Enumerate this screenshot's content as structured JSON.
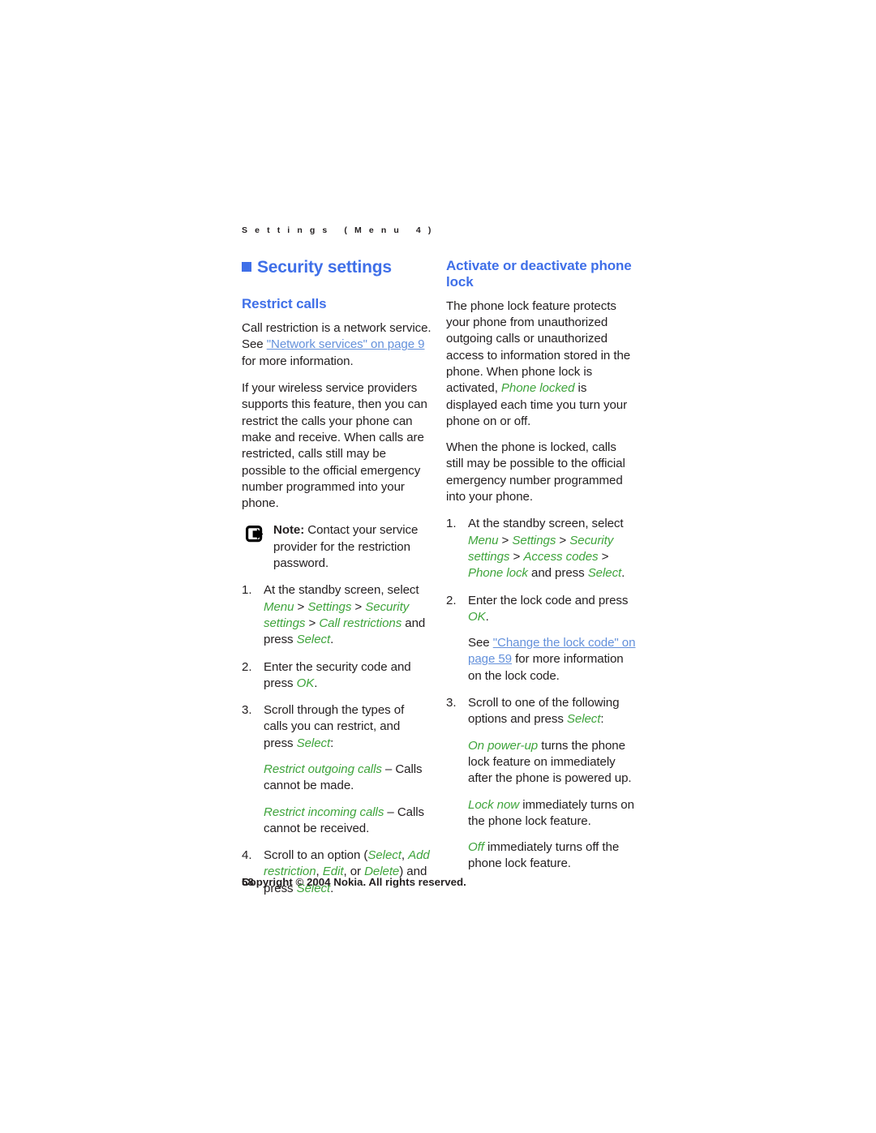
{
  "document": {
    "running_head": "S e t t i n g s   ( M e n u   4 )",
    "page_number": "58",
    "copyright": "Copyright © 2004 Nokia. All rights reserved."
  },
  "colors": {
    "heading_blue": "#3f6fe8",
    "link_blue": "#6491db",
    "ui_green": "#3fa43c",
    "body_black": "#231f20"
  },
  "left_column": {
    "section_title": "Security settings",
    "subsection_title": "Restrict calls",
    "para_1": {
      "before": "Call restriction is a network service. See ",
      "link": "\"Network services\" on page 9",
      "after": " for more information."
    },
    "para_2": "If your wireless service providers supports this feature, then you can restrict the calls your phone can make and receive. When calls are restricted, calls still may be possible to the official emergency number programmed into your phone.",
    "note": {
      "icon": "note-arrow-icon",
      "label": "Note:",
      "text": " Contact your service provider for the restriction password."
    },
    "steps": [
      {
        "num": "1.",
        "parts": [
          {
            "type": "plain",
            "text": "At the standby screen, select "
          },
          {
            "type": "green",
            "text": "Menu"
          },
          {
            "type": "plain",
            "text": " > "
          },
          {
            "type": "green",
            "text": "Settings"
          },
          {
            "type": "plain",
            "text": " > "
          },
          {
            "type": "green",
            "text": "Security settings"
          },
          {
            "type": "plain",
            "text": " > "
          },
          {
            "type": "green",
            "text": "Call restrictions"
          },
          {
            "type": "plain",
            "text": " and press "
          },
          {
            "type": "green",
            "text": "Select"
          },
          {
            "type": "plain",
            "text": "."
          }
        ]
      },
      {
        "num": "2.",
        "parts": [
          {
            "type": "plain",
            "text": "Enter the security code and press "
          },
          {
            "type": "green",
            "text": "OK"
          },
          {
            "type": "plain",
            "text": "."
          }
        ]
      },
      {
        "num": "3.",
        "parts": [
          {
            "type": "plain",
            "text": "Scroll through the types of calls you can restrict, and press "
          },
          {
            "type": "green",
            "text": "Select"
          },
          {
            "type": "plain",
            "text": ":"
          }
        ],
        "substeps": [
          {
            "parts": [
              {
                "type": "green",
                "text": "Restrict outgoing calls"
              },
              {
                "type": "plain",
                "text": " – Calls cannot be made."
              }
            ]
          },
          {
            "parts": [
              {
                "type": "green",
                "text": "Restrict incoming calls"
              },
              {
                "type": "plain",
                "text": " – Calls cannot be received."
              }
            ]
          }
        ]
      },
      {
        "num": "4.",
        "parts": [
          {
            "type": "plain",
            "text": "Scroll to an option ("
          },
          {
            "type": "green",
            "text": "Select"
          },
          {
            "type": "plain",
            "text": ", "
          },
          {
            "type": "green",
            "text": "Add restriction"
          },
          {
            "type": "plain",
            "text": ", "
          },
          {
            "type": "green",
            "text": "Edit"
          },
          {
            "type": "plain",
            "text": ", or "
          },
          {
            "type": "green",
            "text": "Delete"
          },
          {
            "type": "plain",
            "text": ") and press "
          },
          {
            "type": "green",
            "text": "Select"
          },
          {
            "type": "plain",
            "text": "."
          }
        ]
      }
    ]
  },
  "right_column": {
    "subsection_title": "Activate or deactivate phone lock",
    "para_1": {
      "before": "The phone lock feature protects your phone from unauthorized outgoing calls or unauthorized access to information stored in the phone. When phone lock is activated, ",
      "green": "Phone locked",
      "after": " is displayed each time you turn your phone on or off."
    },
    "para_2": "When the phone is locked, calls still may be possible to the official emergency number programmed into your phone.",
    "steps": [
      {
        "num": "1.",
        "parts": [
          {
            "type": "plain",
            "text": "At the standby screen, select "
          },
          {
            "type": "green",
            "text": "Menu"
          },
          {
            "type": "plain",
            "text": " > "
          },
          {
            "type": "green",
            "text": "Settings"
          },
          {
            "type": "plain",
            "text": " > "
          },
          {
            "type": "green",
            "text": "Security settings"
          },
          {
            "type": "plain",
            "text": " > "
          },
          {
            "type": "green",
            "text": "Access codes"
          },
          {
            "type": "plain",
            "text": " > "
          },
          {
            "type": "green",
            "text": "Phone lock"
          },
          {
            "type": "plain",
            "text": " and press "
          },
          {
            "type": "green",
            "text": "Select"
          },
          {
            "type": "plain",
            "text": "."
          }
        ]
      },
      {
        "num": "2.",
        "parts": [
          {
            "type": "plain",
            "text": "Enter the lock code and press "
          },
          {
            "type": "green",
            "text": "OK"
          },
          {
            "type": "plain",
            "text": "."
          }
        ],
        "substeps": [
          {
            "parts": [
              {
                "type": "plain",
                "text": "See "
              },
              {
                "type": "link",
                "text": "\"Change the lock code\" on page 59"
              },
              {
                "type": "plain",
                "text": " for more information on the lock code."
              }
            ]
          }
        ]
      },
      {
        "num": "3.",
        "parts": [
          {
            "type": "plain",
            "text": "Scroll to one of the following options and press "
          },
          {
            "type": "green",
            "text": "Select"
          },
          {
            "type": "plain",
            "text": ":"
          }
        ],
        "substeps": [
          {
            "parts": [
              {
                "type": "green",
                "text": "On power-up"
              },
              {
                "type": "plain",
                "text": " turns the phone lock feature on immediately after the phone is powered up."
              }
            ]
          },
          {
            "parts": [
              {
                "type": "green",
                "text": "Lock now"
              },
              {
                "type": "plain",
                "text": " immediately turns on the phone lock feature."
              }
            ]
          },
          {
            "parts": [
              {
                "type": "green",
                "text": "Off"
              },
              {
                "type": "plain",
                "text": " immediately turns off the phone lock feature."
              }
            ]
          }
        ]
      }
    ]
  }
}
